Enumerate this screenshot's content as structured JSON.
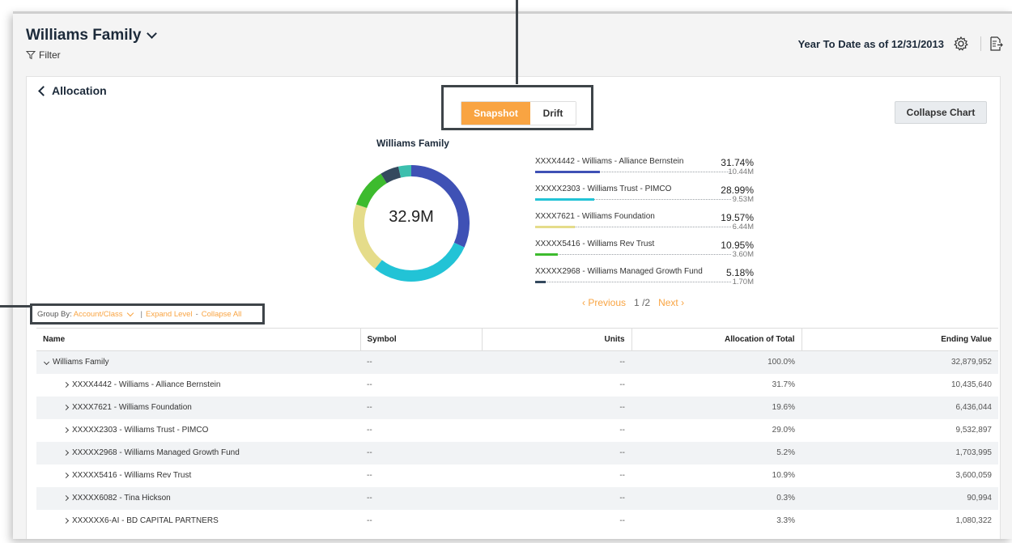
{
  "header": {
    "title": "Williams Family",
    "filter_label": "Filter",
    "as_of": "Year To Date as of 12/31/2013"
  },
  "page": {
    "back_label": "Allocation",
    "toggle": {
      "snapshot": "Snapshot",
      "drift": "Drift",
      "selected": "Snapshot"
    },
    "collapse_chart": "Collapse Chart"
  },
  "chart_data": {
    "type": "pie",
    "title": "Williams Family",
    "center_label": "32.9M",
    "slices": [
      {
        "name": "XXXX4442 - Williams - Alliance Bernstein",
        "percent_label": "31.74%",
        "value_label": "10.44M",
        "percent": 31.74,
        "color": "#3f51b5"
      },
      {
        "name": "XXXXX2303 - Williams Trust - PIMCO",
        "percent_label": "28.99%",
        "value_label": "9.53M",
        "percent": 28.99,
        "color": "#22c3d6"
      },
      {
        "name": "XXXX7621 - Williams Foundation",
        "percent_label": "19.57%",
        "value_label": "6.44M",
        "percent": 19.57,
        "color": "#e5dc8a"
      },
      {
        "name": "XXXXX5416 - Williams Rev Trust",
        "percent_label": "10.95%",
        "value_label": "3.60M",
        "percent": 10.95,
        "color": "#3dbb2e"
      },
      {
        "name": "XXXXX2968 - Williams Managed Growth Fund",
        "percent_label": "5.18%",
        "value_label": "1.70M",
        "percent": 5.18,
        "color": "#34495e"
      },
      {
        "percent": 3.57,
        "color": "#3cbfae"
      }
    ]
  },
  "pager": {
    "prev": "Previous",
    "current": "1",
    "sep": "/",
    "total": "2",
    "next": "Next"
  },
  "groupby": {
    "label": "Group By:",
    "value": "Account/Class",
    "separator": "|",
    "expand": "Expand Level",
    "dash": "-",
    "collapse": "Collapse All"
  },
  "table": {
    "columns": [
      "Name",
      "Symbol",
      "Units",
      "Allocation of Total",
      "Ending Value"
    ],
    "rows": [
      {
        "name": "Williams Family",
        "symbol": "--",
        "units": "--",
        "alloc": "100.0%",
        "ending": "32,879,952"
      },
      {
        "name": "XXXX4442 - Williams - Alliance Bernstein",
        "symbol": "--",
        "units": "--",
        "alloc": "31.7%",
        "ending": "10,435,640"
      },
      {
        "name": "XXXX7621 - Williams Foundation",
        "symbol": "--",
        "units": "--",
        "alloc": "19.6%",
        "ending": "6,436,044"
      },
      {
        "name": "XXXXX2303 - Williams Trust - PIMCO",
        "symbol": "--",
        "units": "--",
        "alloc": "29.0%",
        "ending": "9,532,897"
      },
      {
        "name": "XXXXX2968 - Williams Managed Growth Fund",
        "symbol": "--",
        "units": "--",
        "alloc": "5.2%",
        "ending": "1,703,995"
      },
      {
        "name": "XXXXX5416 - Williams Rev Trust",
        "symbol": "--",
        "units": "--",
        "alloc": "10.9%",
        "ending": "3,600,059"
      },
      {
        "name": "XXXXX6082 - Tina Hickson",
        "symbol": "--",
        "units": "--",
        "alloc": "0.3%",
        "ending": "90,994"
      },
      {
        "name": "XXXXXX6-AI - BD CAPITAL PARTNERS",
        "symbol": "--",
        "units": "--",
        "alloc": "3.3%",
        "ending": "1,080,322"
      }
    ]
  },
  "colors": {
    "accent": "#f9a442",
    "navy": "#1c2a3a",
    "callout": "#3e4449"
  }
}
